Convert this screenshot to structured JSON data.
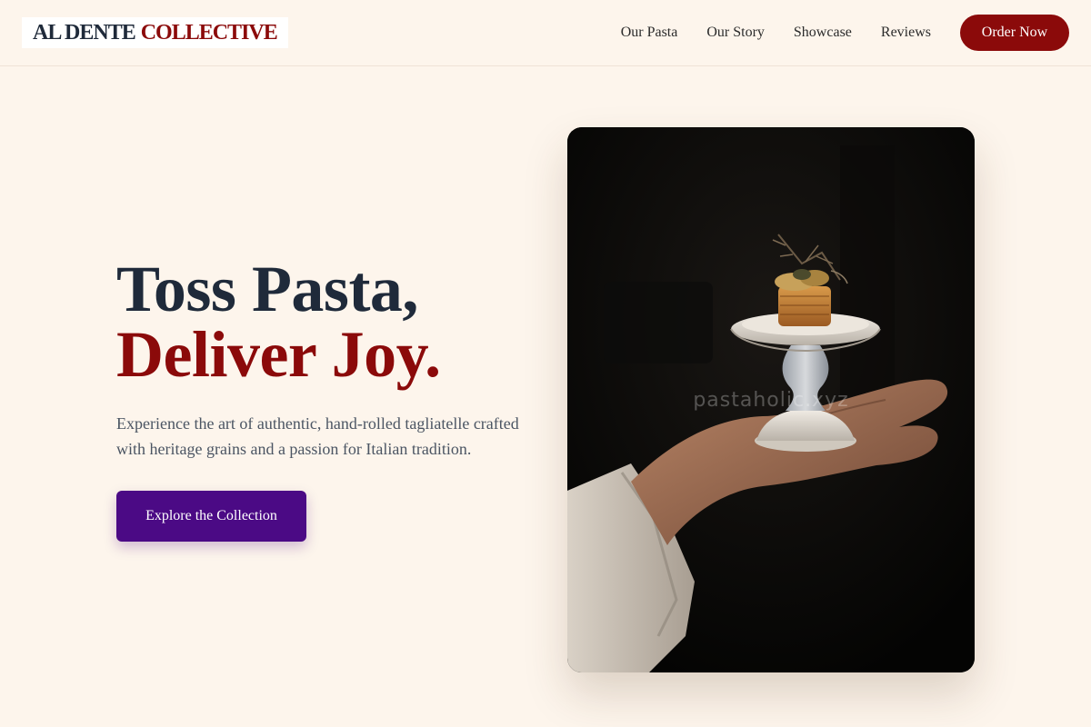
{
  "brand": {
    "name_part_1": "AL DENTE",
    "name_part_2": "COLLECTIVE"
  },
  "nav": {
    "items": [
      {
        "label": "Our Pasta"
      },
      {
        "label": "Our Story"
      },
      {
        "label": "Showcase"
      },
      {
        "label": "Reviews"
      }
    ],
    "cta_label": "Order Now"
  },
  "hero": {
    "title_line_1": "Toss Pasta,",
    "title_line_2": "Deliver Joy.",
    "description": "Experience the art of authentic, hand-rolled tagliatelle crafted with heritage grains and a passion for Italian tradition.",
    "cta_label": "Explore the Collection",
    "image_watermark": "pastaholic.xyz"
  },
  "colors": {
    "background": "#fdf5ec",
    "brand_red": "#8b0a0a",
    "navy": "#1f2a3a",
    "cta_purple": "#4b0a85"
  }
}
